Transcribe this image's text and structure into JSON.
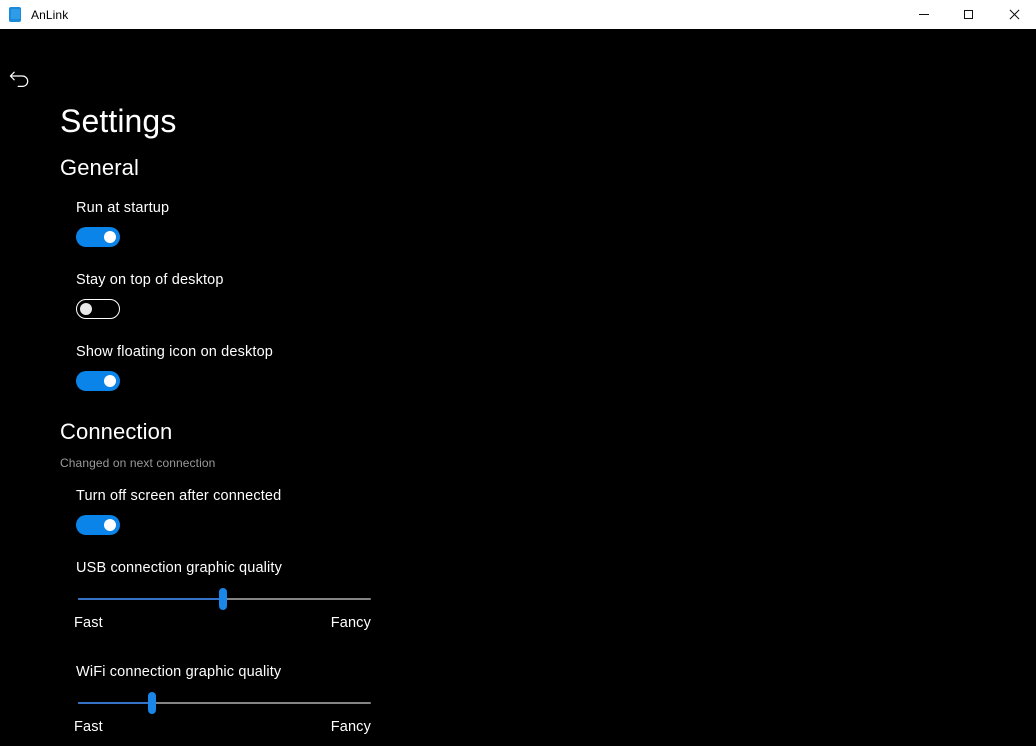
{
  "window": {
    "app_icon": "phone-icon",
    "title": "AnLink",
    "controls": {
      "minimize": "minimize-icon",
      "maximize": "maximize-icon",
      "close": "close-icon"
    }
  },
  "navigation": {
    "back_icon": "back-arrow-icon"
  },
  "page": {
    "title": "Settings"
  },
  "colors": {
    "accent": "#0a84e8",
    "slider_fill": "#3572c8",
    "slider_track": "#848484",
    "background": "#000000",
    "titlebar": "#ffffff",
    "text": "#ffffff",
    "muted_text": "#9a9a9a"
  },
  "sections": [
    {
      "id": "general",
      "heading": "General",
      "note": "",
      "settings": [
        {
          "id": "run-at-startup",
          "label": "Run at startup",
          "type": "toggle",
          "state": "on"
        },
        {
          "id": "stay-on-top",
          "label": "Stay on top of desktop",
          "type": "toggle",
          "state": "off"
        },
        {
          "id": "show-floating-icon",
          "label": "Show floating icon on desktop",
          "type": "toggle",
          "state": "on"
        }
      ]
    },
    {
      "id": "connection",
      "heading": "Connection",
      "note": "Changed on next connection",
      "settings": [
        {
          "id": "turn-off-screen",
          "label": "Turn off screen after connected",
          "type": "toggle",
          "state": "on"
        },
        {
          "id": "usb-quality",
          "label": "USB connection graphic quality",
          "type": "slider",
          "value_percent": 49.5,
          "min_label": "Fast",
          "max_label": "Fancy"
        },
        {
          "id": "wifi-quality",
          "label": "WiFi connection graphic quality",
          "type": "slider",
          "value_percent": 25.3,
          "min_label": "Fast",
          "max_label": "Fancy"
        }
      ]
    }
  ]
}
